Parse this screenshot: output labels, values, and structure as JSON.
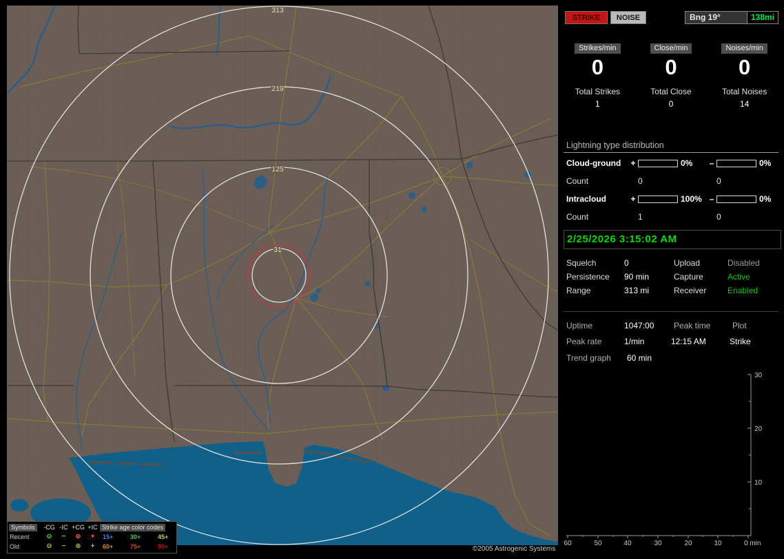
{
  "window": {
    "copyright": "©2005 Astrogenic Systems"
  },
  "map": {
    "ring_labels": {
      "r313": "313",
      "r219": "219",
      "r125": "125",
      "r31": "31"
    },
    "legend": {
      "symbols_header": "Symbols",
      "age_header": "Strike age color codes",
      "col_headers": {
        "ncg": "-CG",
        "nic": "-IC",
        "pcg": "+CG",
        "pic": "+IC"
      },
      "recent": {
        "label": "Recent",
        "sym_ncg": "⊖",
        "sym_nic": "−",
        "sym_pcg": "⊕",
        "sym_pic": "+",
        "neg_color": "#44dd44",
        "pos_color": "#ff5555",
        "ages": [
          {
            "text": "15+",
            "color": "#5577ff"
          },
          {
            "text": "30+",
            "color": "#44cc44"
          },
          {
            "text": "45+",
            "color": "#cccc44"
          }
        ]
      },
      "old": {
        "label": "Old",
        "sym_ncg": "⊖",
        "sym_nic": "−",
        "sym_pcg": "⊕",
        "sym_pic": "+",
        "neg_color": "#bbbb44",
        "pos_color": "#bbbb44",
        "ages": [
          {
            "text": "60+",
            "color": "#dd8822"
          },
          {
            "text": "75+",
            "color": "#dd4422"
          },
          {
            "text": "90+",
            "color": "#cc1111"
          }
        ]
      }
    }
  },
  "panel": {
    "strike_btn": "STRIKE",
    "noise_btn": "NOISE",
    "bearing": "Bng 19°",
    "distance": "138mi",
    "distance_color": "#00ee44",
    "counters": [
      {
        "label": "Strikes/min",
        "value": "0",
        "total_label": "Total Strikes",
        "total": "1"
      },
      {
        "label": "Close/min",
        "value": "0",
        "total_label": "Total Close",
        "total": "0"
      },
      {
        "label": "Noises/min",
        "value": "0",
        "total_label": "Total Noises",
        "total": "14"
      }
    ],
    "distribution": {
      "title": "Lightning type distribution",
      "bar_color": "#ee5f9e",
      "rows": [
        {
          "label": "Cloud-ground",
          "pos_sign": "+",
          "pos_pct": "0%",
          "neg_sign": "–",
          "neg_pct": "0%",
          "count_label": "Count",
          "pos_count": "0",
          "neg_count": "0"
        },
        {
          "label": "Intracloud",
          "pos_sign": "+",
          "pos_pct": "100%",
          "neg_sign": "–",
          "neg_pct": "0%",
          "count_label": "Count",
          "pos_count": "1",
          "neg_count": "0"
        }
      ]
    },
    "datetime": "2/25/2026 3:15:02 AM",
    "datetime_color": "#00dd00",
    "settings": [
      {
        "label": "Squelch",
        "value": "0",
        "label2": "Upload",
        "value2": "Disabled",
        "value2_color": "#9a9a9a"
      },
      {
        "label": "Persistence",
        "value": "90 min",
        "label2": "Capture",
        "value2": "Active",
        "value2_color": "#00cc00"
      },
      {
        "label": "Range",
        "value": "313 mi",
        "label2": "Receiver",
        "value2": "Enabled",
        "value2_color": "#00cc00"
      }
    ],
    "stats": {
      "uptime_label": "Uptime",
      "uptime": "1047:00",
      "peak_time_label": "Peak time",
      "plot_label": "Plot",
      "peak_rate_label": "Peak rate",
      "peak_rate": "1/min",
      "peak_time": "12:15 AM",
      "plot_type": "Strike",
      "trend_label": "Trend graph",
      "trend_value": "60 min"
    }
  },
  "chart_data": {
    "type": "line",
    "title": "Strike trend graph (60 min)",
    "x_ticks": [
      "60",
      "50",
      "40",
      "30",
      "20",
      "10"
    ],
    "x_corner": "0 min",
    "y_ticks": [
      "30",
      "20",
      "10"
    ],
    "x_range": [
      60,
      0
    ],
    "y_range": [
      0,
      30
    ],
    "series": [
      {
        "name": "Strike",
        "values": []
      }
    ]
  }
}
